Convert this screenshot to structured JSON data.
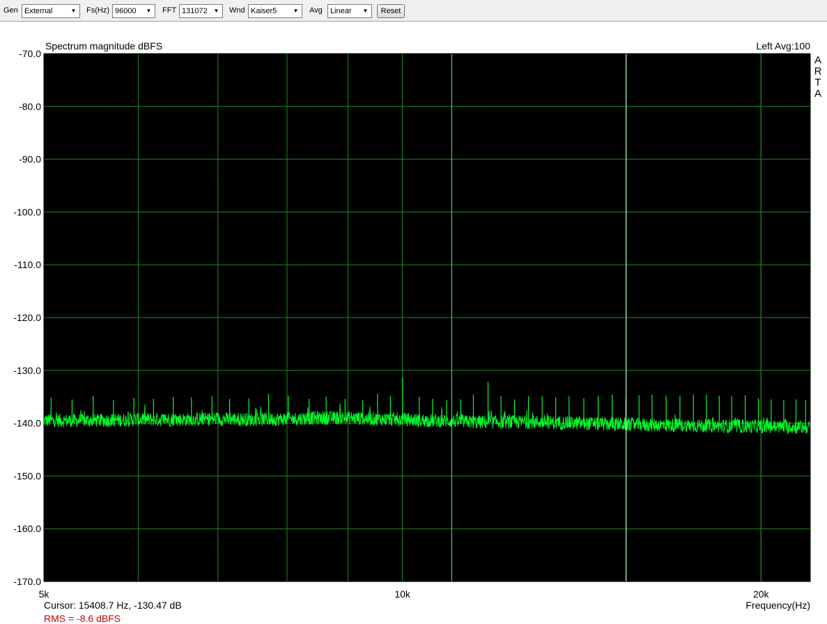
{
  "toolbar": {
    "gen_label": "Gen",
    "gen_value": "External",
    "fs_label": "Fs(Hz)",
    "fs_value": "96000",
    "fft_label": "FFT",
    "fft_value": "131072",
    "wnd_label": "Wnd",
    "wnd_value": "Kaiser5",
    "avg_label": "Avg",
    "avg_value": "Linear",
    "reset_label": "Reset"
  },
  "chart_data": {
    "type": "line",
    "title": "Spectrum magnitude dBFS",
    "channel_label": "Left",
    "avg_label": "Avg:100",
    "watermark": "ARTA",
    "xlabel": "Frequency(Hz)",
    "ylabel": "",
    "xscale": "log",
    "xlim": [
      5000,
      22000
    ],
    "ylim": [
      -170,
      -70
    ],
    "y_ticks": [
      -70,
      -80,
      -90,
      -100,
      -110,
      -120,
      -130,
      -140,
      -150,
      -160,
      -170
    ],
    "y_tick_labels": [
      "-70.0",
      "-80.0",
      "-90.0",
      "-100.0",
      "-110.0",
      "-120.0",
      "-130.0",
      "-140.0",
      "-150.0",
      "-160.0",
      "-170.0"
    ],
    "x_ticks": [
      5000,
      10000,
      20000
    ],
    "x_tick_labels": [
      "5k",
      "10k",
      "20k"
    ],
    "x_minor_grid": [
      6000,
      7000,
      8000,
      9000,
      20000
    ],
    "grid": true,
    "colors": {
      "plot_background": "#000000",
      "grid": "#1e8c1e",
      "trace": "#00ff2a",
      "cursor_line": "#c8ffc8",
      "rms_text": "#c00000"
    },
    "cursor_frequency_hz": 15408.7,
    "series": [
      {
        "x": [
          5000,
          5500,
          6000,
          6500,
          7000,
          7500,
          8000,
          8500,
          9000,
          9500,
          10000,
          10500,
          11000,
          11500,
          12000,
          13000,
          14000,
          15000,
          16000,
          17000,
          18000,
          19000,
          20000,
          21000,
          22000
        ],
        "values": [
          -139.5,
          -139.5,
          -139.3,
          -139.3,
          -139.2,
          -139.3,
          -139.2,
          -139.0,
          -139.0,
          -139.2,
          -139.3,
          -139.5,
          -139.6,
          -139.8,
          -139.8,
          -139.8,
          -140.0,
          -140.2,
          -140.3,
          -140.4,
          -140.5,
          -140.6,
          -140.6,
          -140.7,
          -140.8
        ]
      }
    ],
    "spurs": [
      {
        "x": 5070,
        "y": -135.2
      },
      {
        "x": 5280,
        "y": -135.5
      },
      {
        "x": 5500,
        "y": -134.8
      },
      {
        "x": 5720,
        "y": -135.6
      },
      {
        "x": 5950,
        "y": -135.2
      },
      {
        "x": 6180,
        "y": -135.4
      },
      {
        "x": 6420,
        "y": -135.0
      },
      {
        "x": 6650,
        "y": -135.1
      },
      {
        "x": 6920,
        "y": -134.9
      },
      {
        "x": 7160,
        "y": -135.4
      },
      {
        "x": 7430,
        "y": -135.3
      },
      {
        "x": 7720,
        "y": -134.5
      },
      {
        "x": 8020,
        "y": -134.8
      },
      {
        "x": 8350,
        "y": -135.4
      },
      {
        "x": 8630,
        "y": -135.0
      },
      {
        "x": 8950,
        "y": -135.4
      },
      {
        "x": 9260,
        "y": -135.6
      },
      {
        "x": 9530,
        "y": -134.5
      },
      {
        "x": 9770,
        "y": -134.8
      },
      {
        "x": 10000,
        "y": -131.3
      },
      {
        "x": 10330,
        "y": -135.0
      },
      {
        "x": 10600,
        "y": -135.4
      },
      {
        "x": 10890,
        "y": -135.6
      },
      {
        "x": 11190,
        "y": -135.5
      },
      {
        "x": 11470,
        "y": -134.6
      },
      {
        "x": 11800,
        "y": -132.2
      },
      {
        "x": 12100,
        "y": -134.9
      },
      {
        "x": 12420,
        "y": -135.5
      },
      {
        "x": 12760,
        "y": -134.9
      },
      {
        "x": 13100,
        "y": -134.9
      },
      {
        "x": 13450,
        "y": -135.1
      },
      {
        "x": 13800,
        "y": -134.9
      },
      {
        "x": 14200,
        "y": -135.3
      },
      {
        "x": 14600,
        "y": -134.8
      },
      {
        "x": 15000,
        "y": -134.6
      },
      {
        "x": 15400,
        "y": -135.4
      },
      {
        "x": 15800,
        "y": -134.7
      },
      {
        "x": 16200,
        "y": -134.6
      },
      {
        "x": 16650,
        "y": -134.8
      },
      {
        "x": 17100,
        "y": -134.8
      },
      {
        "x": 17550,
        "y": -134.6
      },
      {
        "x": 18000,
        "y": -134.6
      },
      {
        "x": 18450,
        "y": -134.8
      },
      {
        "x": 18900,
        "y": -134.9
      },
      {
        "x": 19400,
        "y": -134.7
      },
      {
        "x": 19900,
        "y": -135.3
      },
      {
        "x": 20400,
        "y": -135.5
      },
      {
        "x": 20900,
        "y": -135.6
      },
      {
        "x": 21400,
        "y": -135.5
      },
      {
        "x": 21800,
        "y": -135.6
      }
    ],
    "annotations": {
      "cursor_text": "Cursor: 15408.7 Hz, -130.47 dB",
      "rms_text": "RMS =   -8.6 dBFS"
    }
  }
}
